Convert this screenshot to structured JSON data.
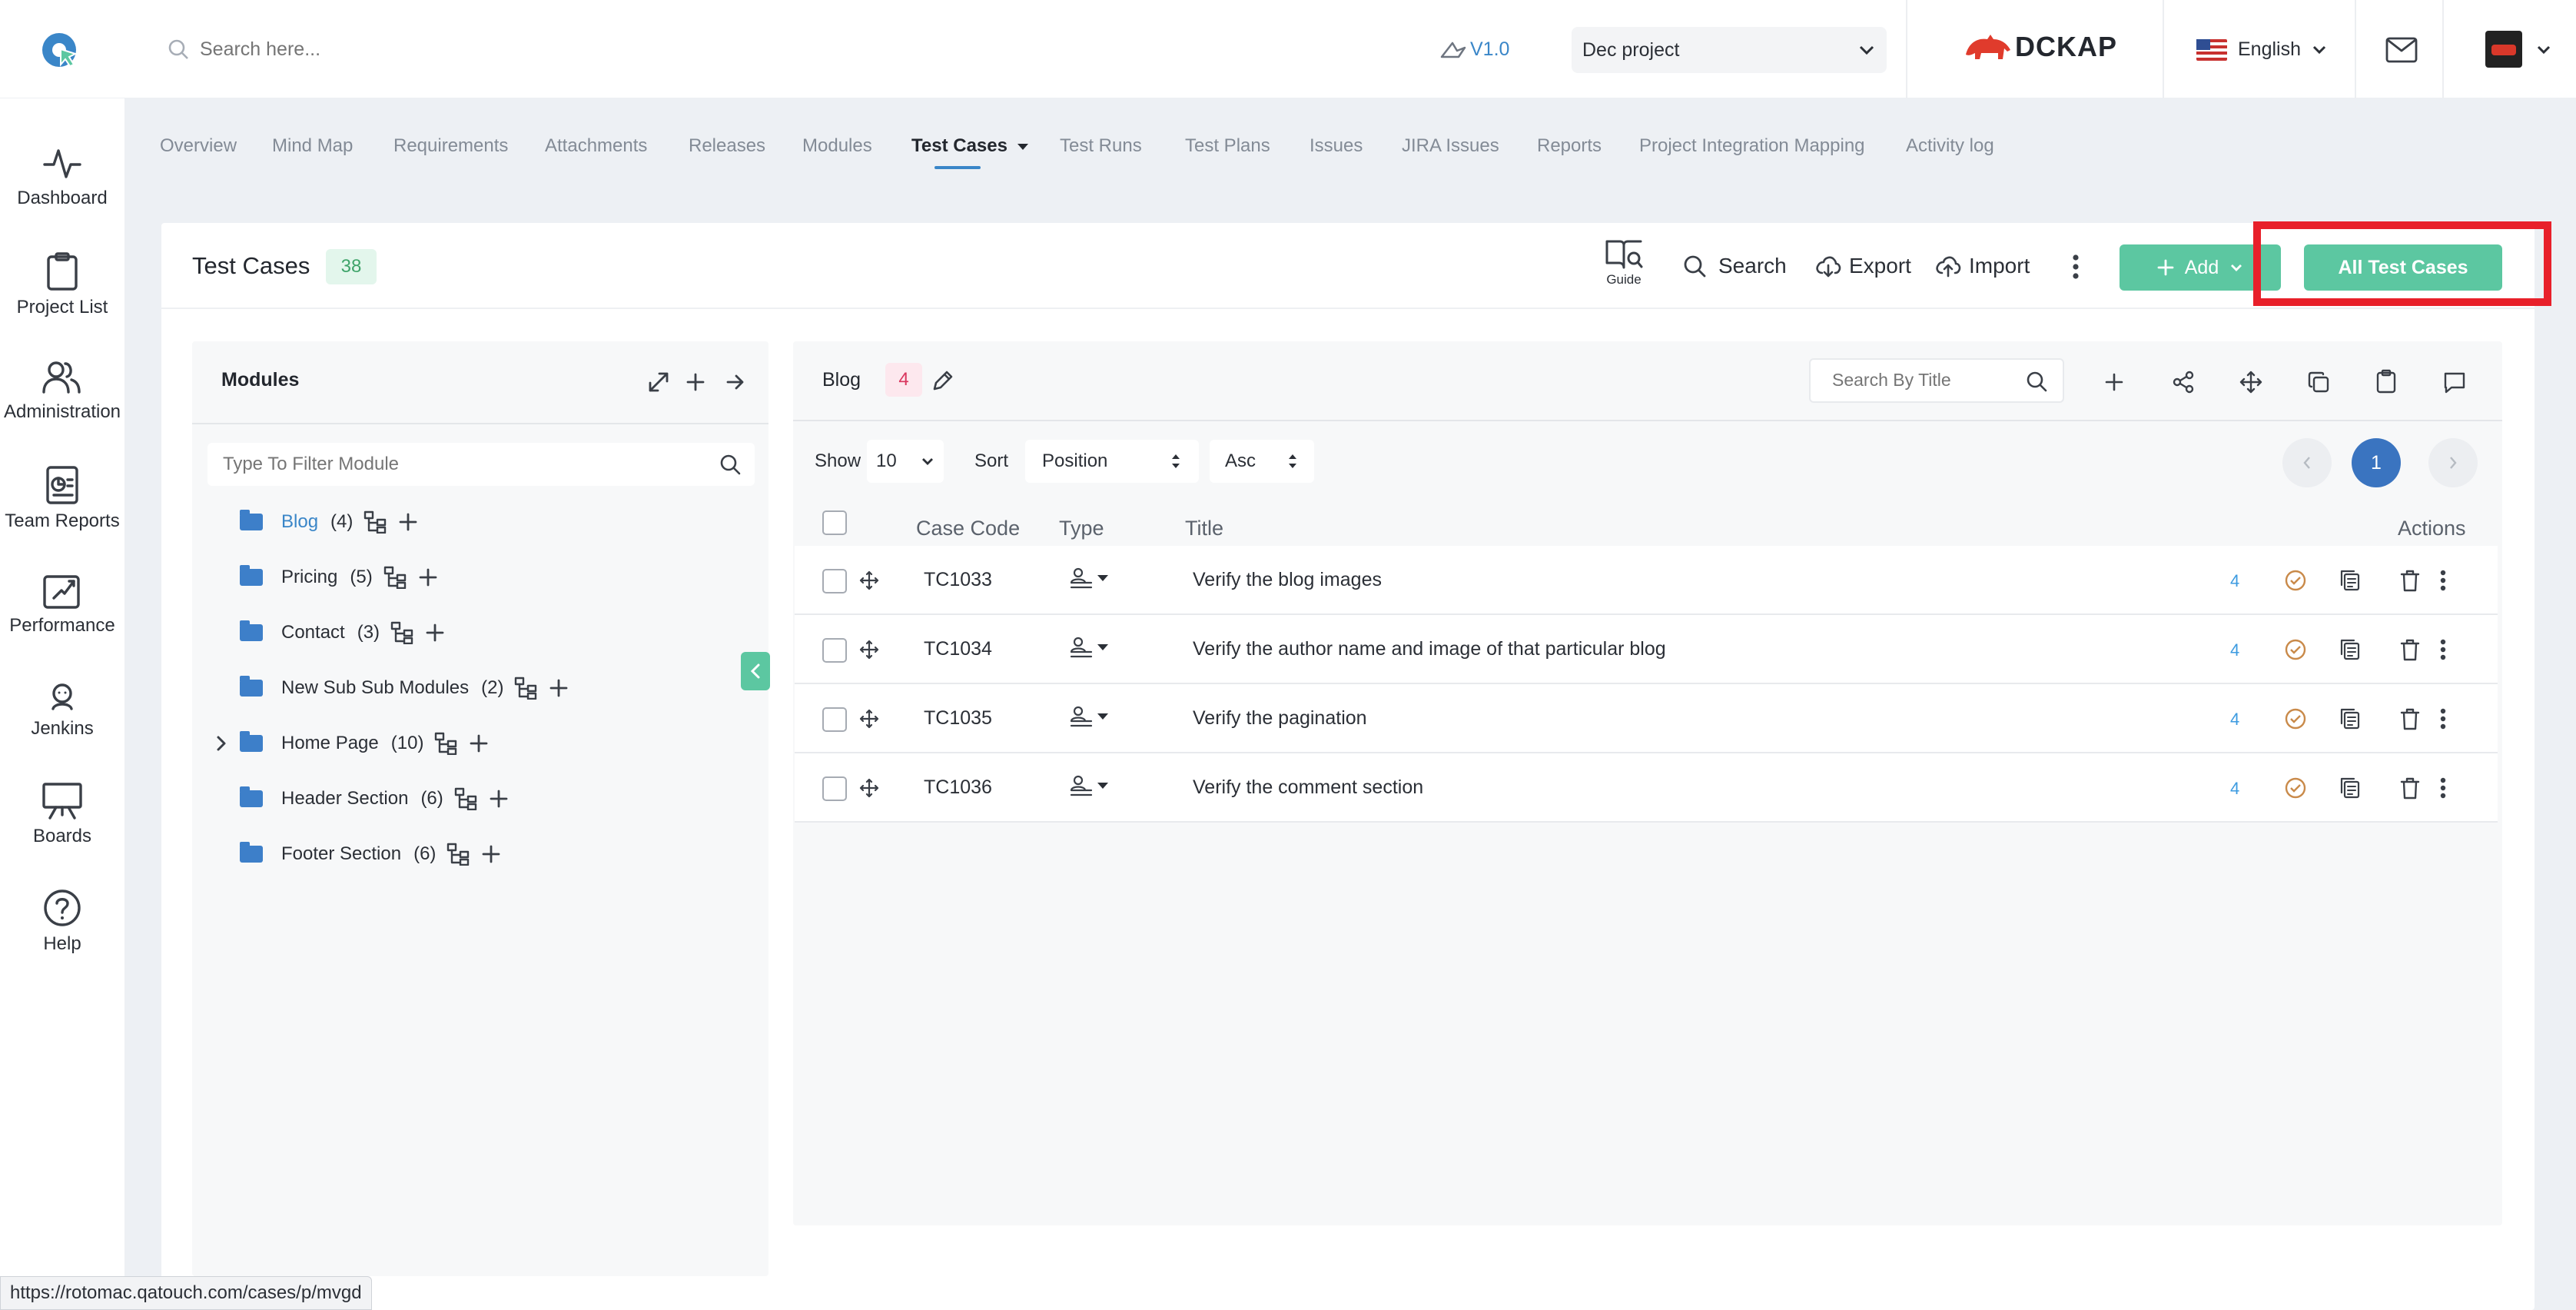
{
  "header": {
    "search_placeholder": "Search here...",
    "version": "V1.0",
    "project": "Dec project",
    "brand": "DCKAP",
    "language": "English"
  },
  "sidebar": {
    "items": [
      {
        "label": "Dashboard",
        "icon": "pulse-icon"
      },
      {
        "label": "Project List",
        "icon": "clipboard-icon"
      },
      {
        "label": "Administration",
        "icon": "users-icon"
      },
      {
        "label": "Team Reports",
        "icon": "report-icon"
      },
      {
        "label": "Performance",
        "icon": "rocket-icon"
      },
      {
        "label": "Jenkins",
        "icon": "jenkins-icon"
      },
      {
        "label": "Boards",
        "icon": "board-icon"
      },
      {
        "label": "Help",
        "icon": "help-icon"
      }
    ]
  },
  "tabs": [
    "Overview",
    "Mind Map",
    "Requirements",
    "Attachments",
    "Releases",
    "Modules",
    "Test Cases",
    "Test Runs",
    "Test Plans",
    "Issues",
    "JIRA Issues",
    "Reports",
    "Project Integration Mapping",
    "Activity log"
  ],
  "active_tab": "Test Cases",
  "page": {
    "title": "Test Cases",
    "count": "38",
    "guide": "Guide",
    "search": "Search",
    "export": "Export",
    "import": "Import",
    "add": "Add",
    "all_test_cases": "All Test Cases"
  },
  "modules": {
    "title": "Modules",
    "filter_placeholder": "Type To Filter Module",
    "items": [
      {
        "name": "Blog",
        "count": "(4)"
      },
      {
        "name": "Pricing",
        "count": "(5)"
      },
      {
        "name": "Contact",
        "count": "(3)"
      },
      {
        "name": "New Sub Sub Modules",
        "count": "(2)"
      },
      {
        "name": "Home Page",
        "count": "(10)"
      },
      {
        "name": "Header Section",
        "count": "(6)"
      },
      {
        "name": "Footer Section",
        "count": "(6)"
      }
    ]
  },
  "list": {
    "module": "Blog",
    "count": "4",
    "search_placeholder": "Search By Title",
    "show_label": "Show",
    "show_value": "10",
    "sort_label": "Sort",
    "sort_value": "Position",
    "order_value": "Asc",
    "page": "1",
    "columns": {
      "code": "Case Code",
      "type": "Type",
      "title": "Title",
      "actions": "Actions"
    },
    "rows": [
      {
        "code": "TC1033",
        "title": "Verify the blog images",
        "badge": "4"
      },
      {
        "code": "TC1034",
        "title": "Verify the author name and image of that particular blog",
        "badge": "4"
      },
      {
        "code": "TC1035",
        "title": "Verify the pagination",
        "badge": "4"
      },
      {
        "code": "TC1036",
        "title": "Verify the comment section",
        "badge": "4"
      }
    ]
  },
  "status_url": "https://rotomac.qatouch.com/cases/p/mvgd",
  "colors": {
    "accent": "#5cc7a1",
    "highlight": "#e8202a",
    "link": "#3a86c8",
    "folder": "#3d7fc9"
  }
}
